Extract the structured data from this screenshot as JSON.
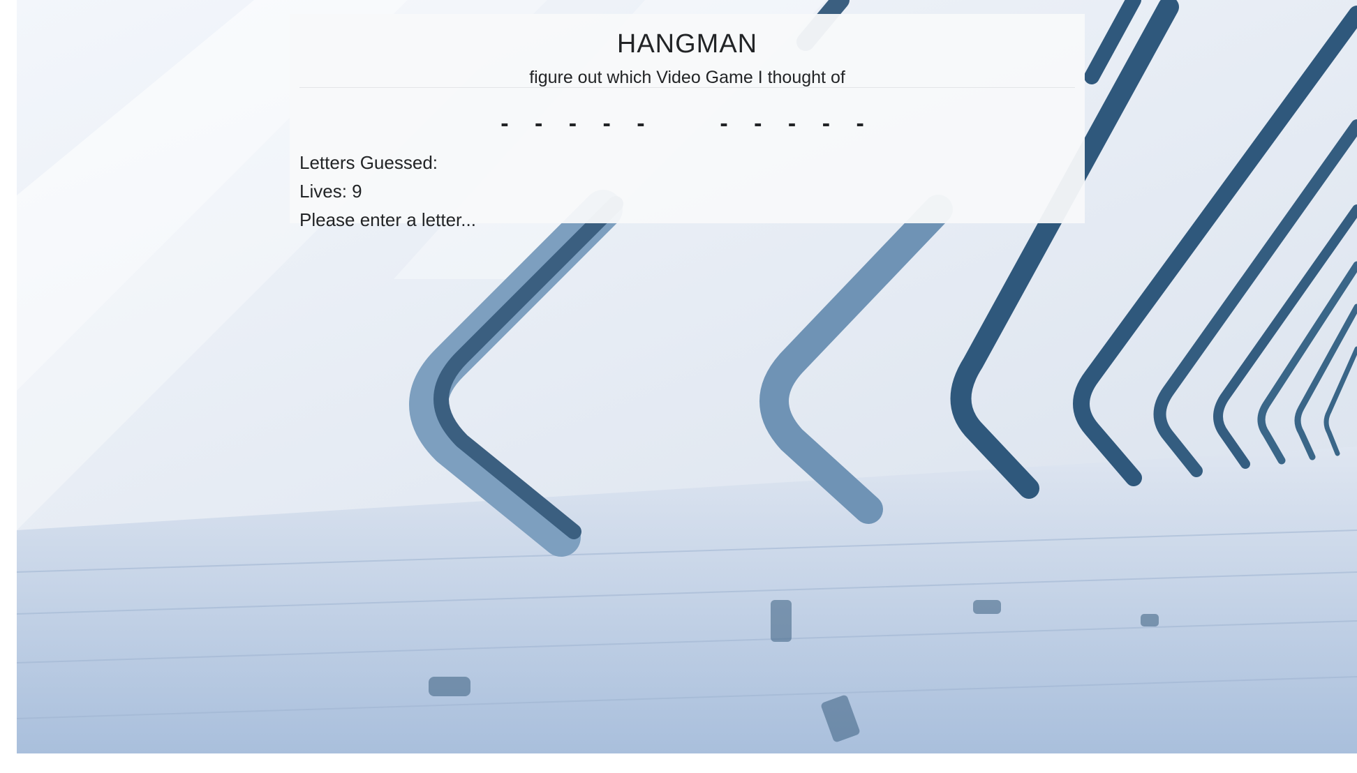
{
  "game": {
    "title": "HANGMAN",
    "subtitle": "figure out which Video Game I thought of",
    "word_display": "- - - - -    - - - - -",
    "letters_guessed_label": "Letters Guessed:",
    "letters_guessed_value": "",
    "lives_label": "Lives:",
    "lives_value": "9",
    "prompt": "Please enter a letter..."
  },
  "colors": {
    "panel_background": "#f8f9fa",
    "text": "#222426",
    "pillar": "#3a6688",
    "floor": "#b9cbe2"
  }
}
